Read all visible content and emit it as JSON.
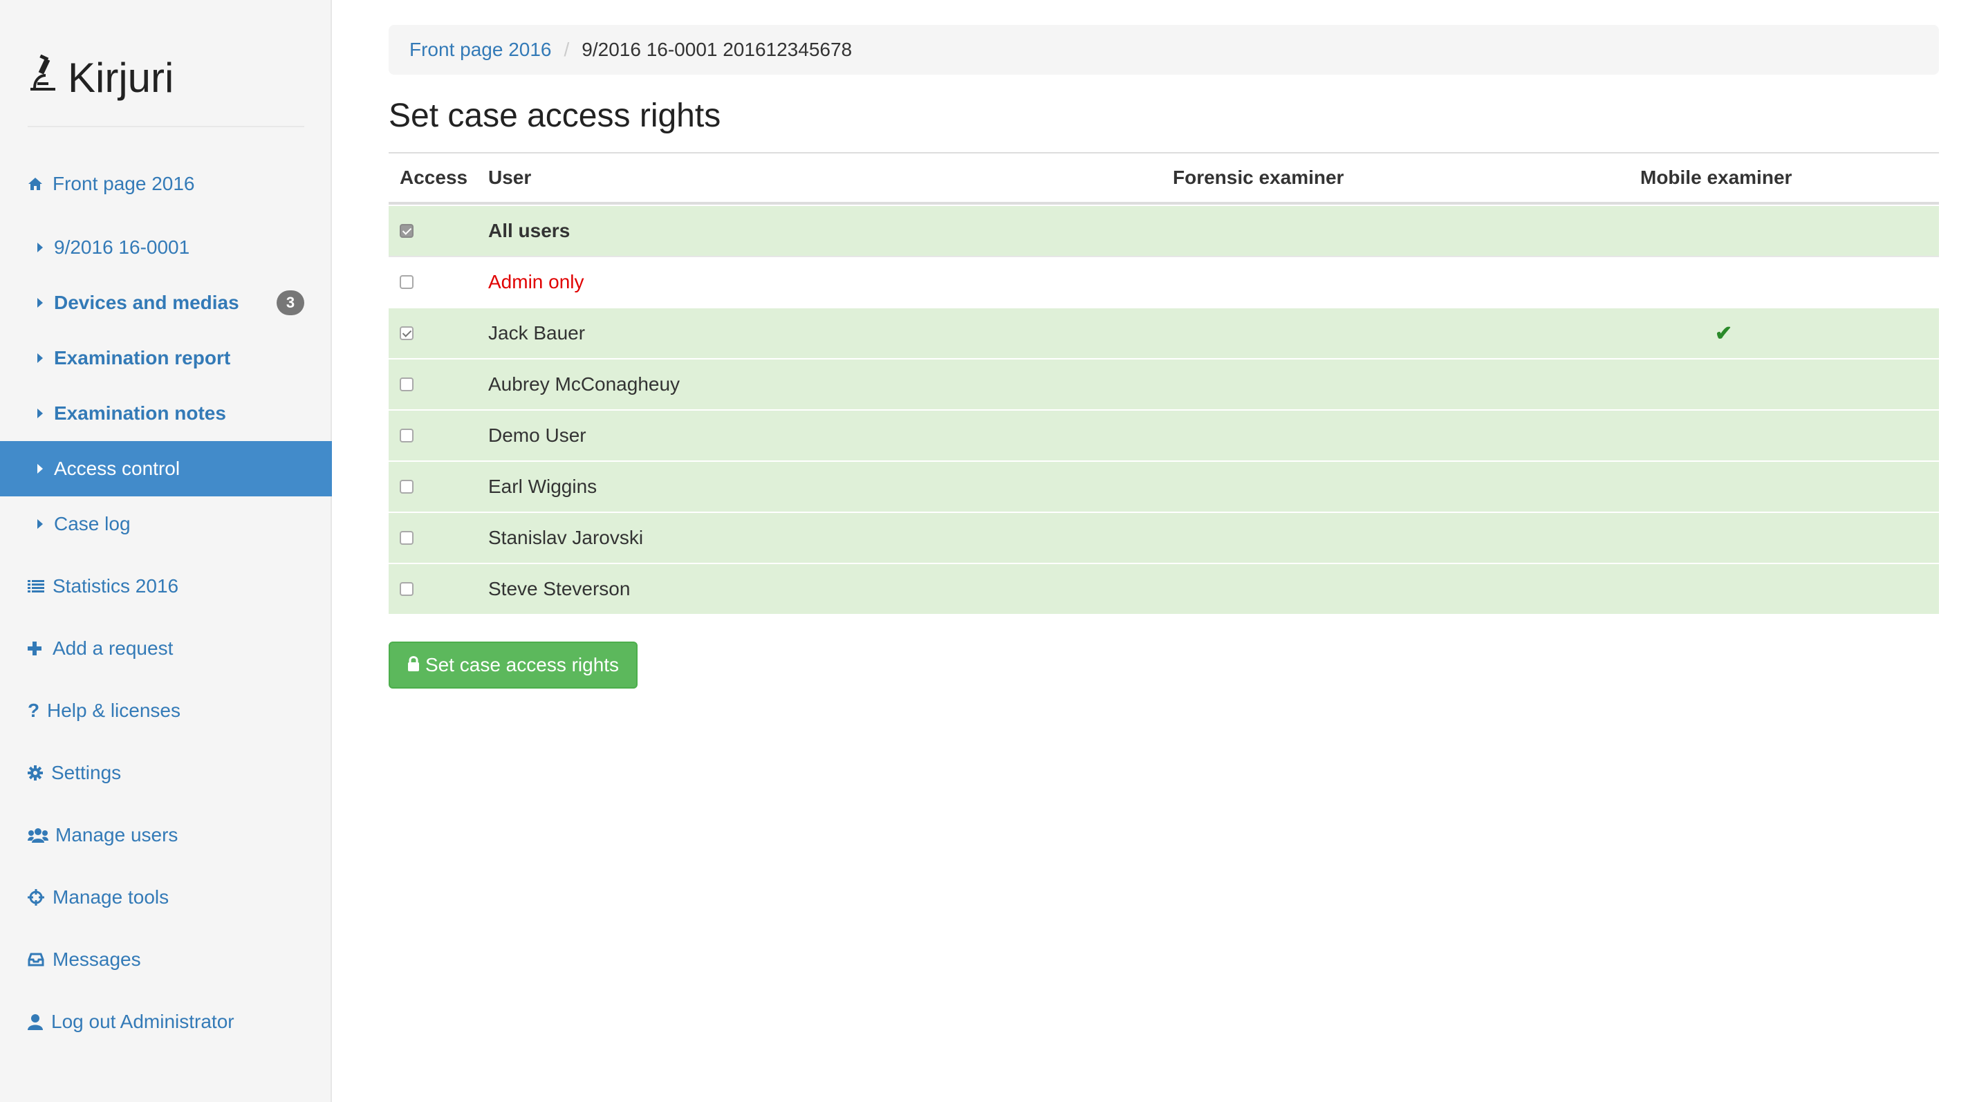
{
  "app": {
    "brand": "Kirjuri"
  },
  "colors": {
    "link": "#337ab7",
    "active_bg": "#428bca",
    "success": "#5cb85c",
    "row_green": "#dff0d8",
    "admin_red": "#e00000"
  },
  "sidebar": {
    "items": [
      {
        "label": "Front page 2016",
        "icon": "home-icon"
      },
      {
        "label": "9/2016 16-0001",
        "icon": "caret-right-icon"
      },
      {
        "label": "Devices and medias",
        "icon": "caret-right-icon",
        "badge": "3"
      },
      {
        "label": "Examination report",
        "icon": "caret-right-icon"
      },
      {
        "label": "Examination notes",
        "icon": "caret-right-icon"
      },
      {
        "label": "Access control",
        "icon": "caret-right-icon",
        "active": true
      },
      {
        "label": "Case log",
        "icon": "caret-right-icon"
      },
      {
        "label": "Statistics 2016",
        "icon": "list-icon"
      },
      {
        "label": "Add a request",
        "icon": "plus-icon"
      },
      {
        "label": "Help & licenses",
        "icon": "question-icon"
      },
      {
        "label": "Settings",
        "icon": "gear-icon"
      },
      {
        "label": "Manage users",
        "icon": "users-icon"
      },
      {
        "label": "Manage tools",
        "icon": "crosshairs-icon"
      },
      {
        "label": "Messages",
        "icon": "inbox-icon"
      },
      {
        "label": "Log out Administrator",
        "icon": "user-icon"
      }
    ]
  },
  "breadcrumb": {
    "link": "Front page 2016",
    "separator": "/",
    "current": "9/2016 16-0001 201612345678"
  },
  "main": {
    "title": "Set case access rights",
    "table": {
      "headers": {
        "access": "Access",
        "user": "User",
        "forensic": "Forensic examiner",
        "mobile": "Mobile examiner"
      },
      "rows": [
        {
          "user": "All users",
          "checked": true,
          "style": "bold"
        },
        {
          "user": "Admin only",
          "checked": false,
          "style": "red"
        },
        {
          "user": "Jack Bauer",
          "checked": true,
          "mobile_examiner": "✔"
        },
        {
          "user": "Aubrey McConagheuy",
          "checked": false
        },
        {
          "user": "Demo User",
          "checked": false
        },
        {
          "user": "Earl Wiggins",
          "checked": false
        },
        {
          "user": "Stanislav Jarovski",
          "checked": false
        },
        {
          "user": "Steve Steverson",
          "checked": false
        }
      ]
    },
    "submit_label": "Set case access rights"
  }
}
